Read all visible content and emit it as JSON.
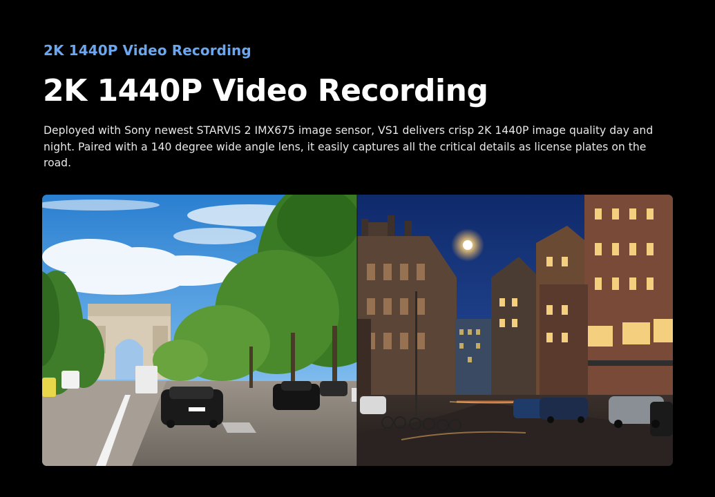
{
  "section": {
    "eyebrow": "2K 1440P Video Recording",
    "title": "2K 1440P Video Recording",
    "description": "Deployed with Sony newest STARVIS 2 IMX675 image sensor, VS1 delivers crisp 2K 1440P image quality day and night. Paired with a 140 degree wide angle lens, it easily captures all the critical details as license plates on the road."
  },
  "colors": {
    "background": "#000000",
    "eyebrow": "#6aa7ee",
    "title": "#ffffff",
    "body_text": "#e8e8e8"
  },
  "media": {
    "left_panel": "daytime-street-arc-de-triomphe",
    "right_panel": "nighttime-city-street-canal-houses"
  }
}
